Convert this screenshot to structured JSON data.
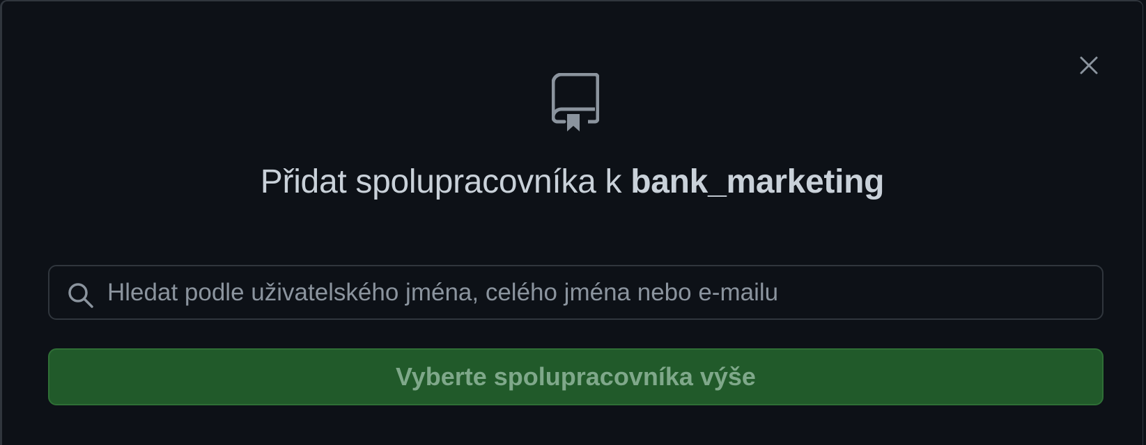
{
  "dialog": {
    "title_prefix": "Přidat spolupracovníka k ",
    "repo_name": "bank_marketing",
    "repo_icon": "repo-book-icon",
    "close_icon": "close-icon"
  },
  "search": {
    "placeholder": "Hledat podle uživatelského jména, celého jména nebo e-mailu",
    "value": "",
    "icon": "search-icon"
  },
  "submit": {
    "label": "Vyberte spolupracovníka výše",
    "disabled": true
  },
  "colors": {
    "background": "#0d1117",
    "border": "#30363d",
    "text": "#c9d1d9",
    "muted": "#8b949e",
    "button_bg": "#215a2a",
    "button_text": "#7fa88a"
  }
}
